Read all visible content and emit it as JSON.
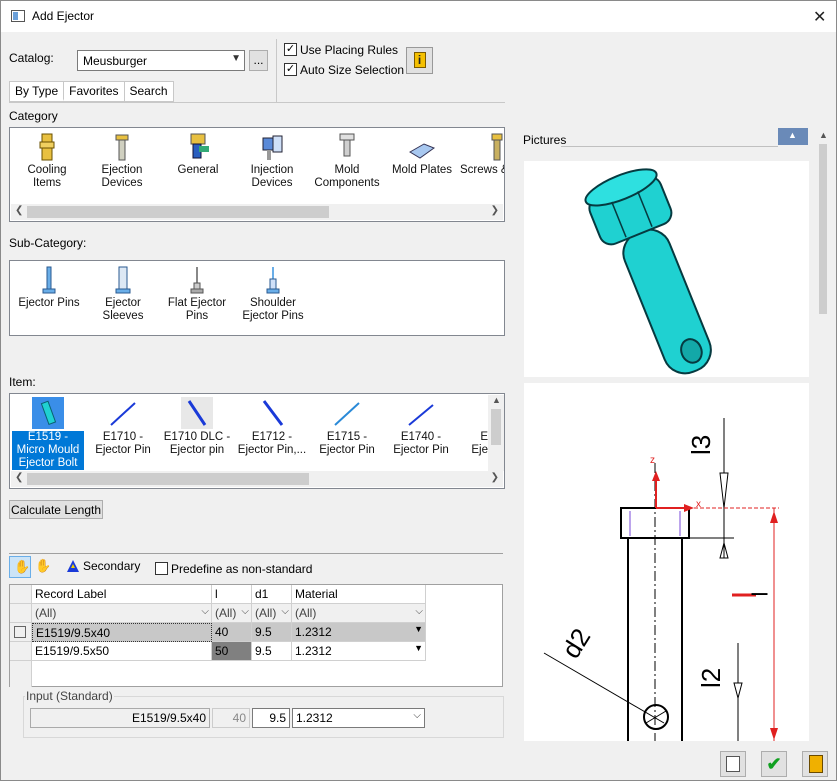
{
  "window": {
    "title": "Add Ejector"
  },
  "catalog": {
    "label": "Catalog:",
    "value": "Meusburger",
    "more": "..."
  },
  "options": {
    "use_placing_rules": "Use Placing Rules",
    "auto_size": "Auto Size Selection"
  },
  "tabs": [
    "By Type",
    "Favorites",
    "Search"
  ],
  "category": {
    "label": "Category",
    "items": [
      "Cooling Items",
      "Ejection Devices",
      "General",
      "Injection Devices",
      "Mold Components",
      "Mold Plates",
      "Screws &"
    ]
  },
  "subcategory": {
    "label": "Sub-Category:",
    "items": [
      "Ejector Pins",
      "Ejector Sleeves",
      "Flat Ejector Pins",
      "Shoulder Ejector Pins"
    ]
  },
  "item": {
    "label": "Item:",
    "items": [
      "E1519 - Micro Mould Ejector Bolt",
      "E1710 - Ejector Pin",
      "E1710 DLC - Ejector pin",
      "E1712 - Ejector Pin,...",
      "E1715 - Ejector Pin",
      "E1740 - Ejector Pin",
      "E Eje"
    ]
  },
  "calc": {
    "label": "Calculate Length"
  },
  "grid": {
    "secondary": "Secondary",
    "predefine": "Predefine as non-standard",
    "headers": [
      "Record Label",
      "l",
      "d1",
      "Material"
    ],
    "filter": [
      "(All)",
      "(All)",
      "(All)",
      "(All)"
    ],
    "rows": [
      [
        "E1519/9.5x40",
        "40",
        "9.5",
        "1.2312"
      ],
      [
        "E1519/9.5x50",
        "50",
        "9.5",
        "1.2312"
      ]
    ]
  },
  "input": {
    "label": "Input (Standard)",
    "record": "E1519/9.5x40",
    "l": "40",
    "d1": "9.5",
    "material": "1.2312"
  },
  "pictures": {
    "label": "Pictures",
    "dim_l3": "l3",
    "dim_l": "l",
    "dim_l2": "l2",
    "dim_d2": "d2",
    "axis_z": "z",
    "axis_x": "x"
  },
  "colors": {
    "part": "#1fd1d1",
    "accent_red": "#e02020"
  }
}
